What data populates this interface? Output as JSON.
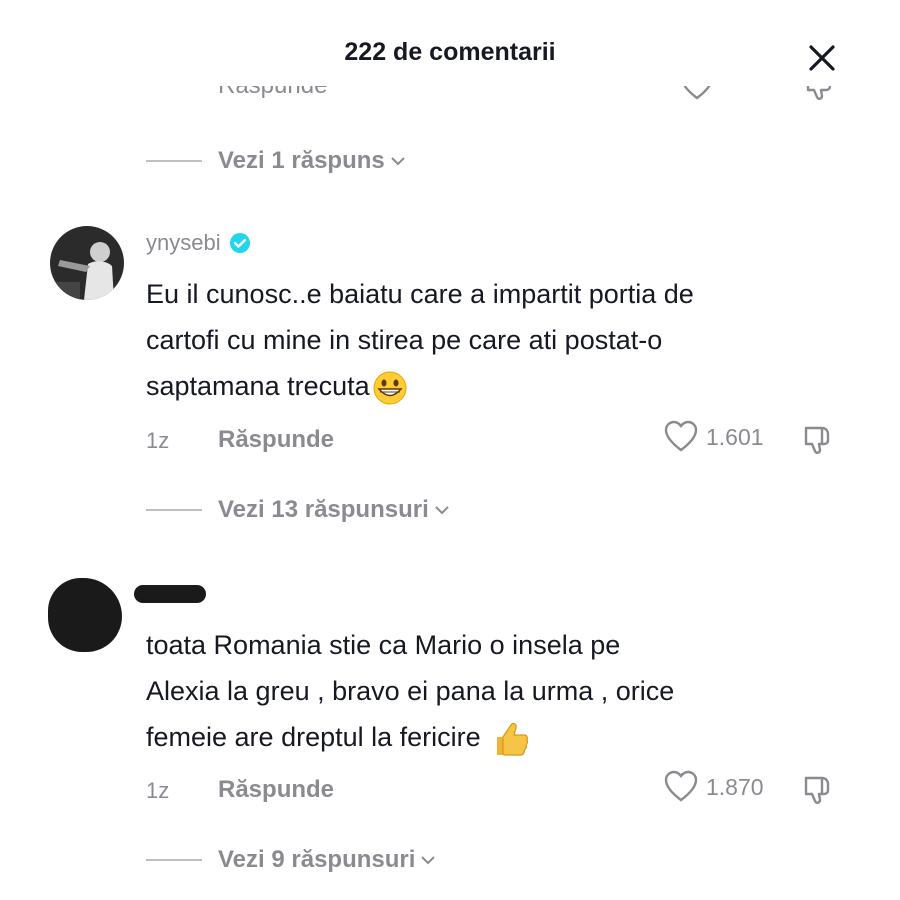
{
  "header": {
    "title": "222 de comentarii"
  },
  "clipped": {
    "reply_label": "Răspunde"
  },
  "thread0": {
    "replies_label": "Vezi 1 răspuns"
  },
  "comments": [
    {
      "username": "ynysebi",
      "verified": true,
      "text": "Eu il cunosc..e baiatu care a impartit portia de\ncartofi cu mine in stirea pe care ati postat-o\nsaptamana trecuta",
      "emoji": "grinning-face",
      "time": "1z",
      "reply_label": "Răspunde",
      "likes": "1.601",
      "replies_label": "Vezi 13 răspunsuri"
    },
    {
      "username": "",
      "verified": false,
      "text": "toata Romania stie ca Mario o insela pe\nAlexia la greu , bravo ei pana la urma , orice\nfemeie are dreptul la fericire",
      "emoji": "thumbs-up",
      "time": "1z",
      "reply_label": "Răspunde",
      "likes": "1.870",
      "replies_label": "Vezi 9 răspunsuri"
    }
  ],
  "colors": {
    "text": "#161823",
    "muted": "#8a8b91",
    "verified": "#20d5ec"
  }
}
